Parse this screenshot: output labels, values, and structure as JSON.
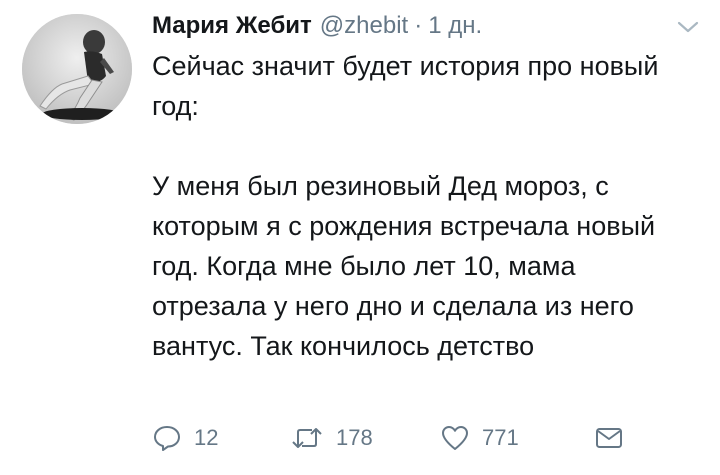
{
  "tweet": {
    "author_name": "Мария Жебит",
    "author_handle": "@zhebit",
    "separator": "·",
    "timestamp": "1 дн.",
    "paragraphs": [
      "Сейчас значит будет история про новый год:",
      "У меня был резиновый Дед мороз, с которым я с рождения встречала новый год. Когда мне было лет 10, мама отрезала у него дно и сделала из него вантус. Так кончилось детство"
    ],
    "counts": {
      "replies": "12",
      "retweets": "178",
      "likes": "771"
    }
  },
  "colors": {
    "text": "#14171a",
    "secondary": "#657786",
    "background": "#ffffff"
  },
  "icons": [
    "avatar-photo",
    "chevron-down-icon",
    "reply-icon",
    "retweet-icon",
    "like-icon",
    "direct-message-icon"
  ]
}
